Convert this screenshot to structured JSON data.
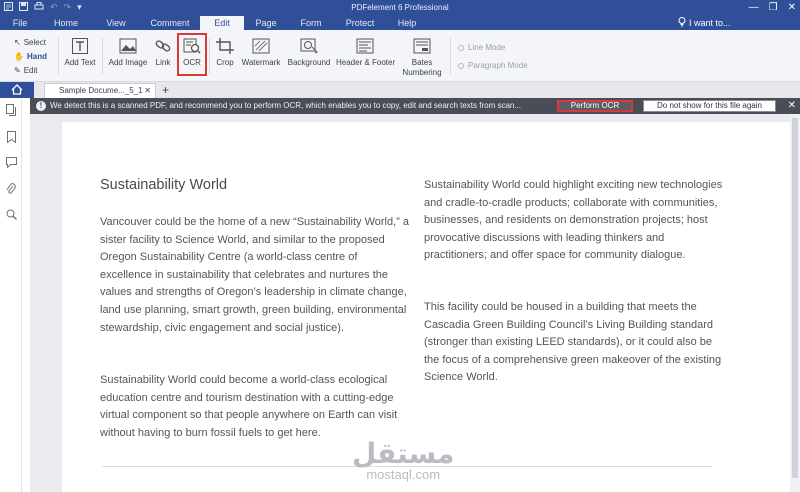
{
  "app": {
    "title": "PDFelement 6 Professional",
    "i_want_to": "I want to..."
  },
  "menu": {
    "items": [
      "File",
      "Home",
      "View",
      "Comment",
      "Edit",
      "Page",
      "Form",
      "Protect",
      "Help"
    ],
    "active": "Edit"
  },
  "ribbon": {
    "select": "Select",
    "hand": "Hand",
    "edit": "Edit",
    "tools": [
      {
        "label": "Add Text",
        "icon": "add-text-icon"
      },
      {
        "label": "Add Image",
        "icon": "add-image-icon"
      },
      {
        "label": "Link",
        "icon": "link-icon"
      },
      {
        "label": "OCR",
        "icon": "ocr-icon"
      },
      {
        "label": "Crop",
        "icon": "crop-icon"
      },
      {
        "label": "Watermark",
        "icon": "watermark-icon"
      },
      {
        "label": "Background",
        "icon": "background-icon"
      },
      {
        "label": "Header & Footer",
        "icon": "header-footer-icon"
      },
      {
        "label": "Bates\nNumbering",
        "icon": "bates-numbering-icon"
      }
    ],
    "line_mode": "Line Mode",
    "paragraph_mode": "Paragraph Mode"
  },
  "tabs": {
    "document_tab": "Sample Docume..._5_1",
    "add_tab": "+"
  },
  "banner": {
    "message": "We detect this is a scanned PDF, and recommend you to perform OCR, which enables you to copy, edit and search texts from scan...",
    "perform_ocr": "Perform OCR",
    "do_not_show": "Do not show for this file again"
  },
  "document": {
    "heading": "Sustainability World",
    "para1": "Vancouver could be the home of a new “Sustainability World,” a sister facility to Science World, and similar to the proposed Oregon Sustainability Centre (a world-class centre of excellence in sustainability that celebrates and nurtures the values and strengths of Oregon’s leadership in climate change, land use planning, smart growth, green building, environmental stewardship, civic engagement and social justice).",
    "para2": "Sustainability World could become a world-class ecological education centre and tourism destination with a cutting-edge virtual component so that people anywhere on Earth can visit without having to burn fossil fuels to get here.",
    "para3": "Sustainability World could highlight exciting new technologies and cradle-to-cradle products; collaborate with communities, businesses, and residents on demonstration projects; host provocative discussions with leading thinkers and practitioners; and offer space for community dialogue.",
    "para4": "This facility could be housed in a building that meets the Cascadia Green Building Council’s Living Building standard (stronger than existing LEED standards), or it could also be the focus of a comprehensive green makeover of the existing Science World."
  },
  "watermark": {
    "arabic": "مستقل",
    "latin": "mostaql.com"
  },
  "colors": {
    "titlebar": "#2f4f98",
    "ribbon": "#f4f5f8",
    "banner": "#4a4d55",
    "highlight": "#d83a3a"
  }
}
